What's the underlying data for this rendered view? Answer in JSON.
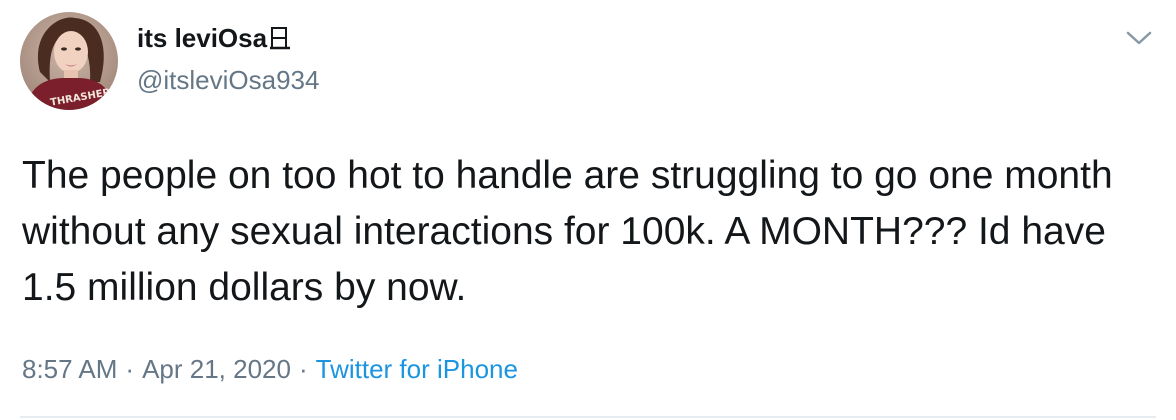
{
  "tweet": {
    "display_name": "its leviOsa",
    "handle": "@itsleviOsa934",
    "text": "The people on too hot to handle are struggling to go one month without any sexual interactions for 100k. A MONTH??? Id have 1.5 million dollars by now.",
    "time": "8:57 AM",
    "separator": "·",
    "date": "Apr 21, 2020",
    "source": "Twitter for iPhone",
    "avatar_shirt_text": "THRASHER"
  },
  "icons": {
    "menu": "chevron-down-icon",
    "name_emoji": "tofu-glyph-icon"
  },
  "colors": {
    "text": "#14171a",
    "secondary": "#657786",
    "link": "#1b95e0",
    "divider": "#e6ecf0"
  }
}
